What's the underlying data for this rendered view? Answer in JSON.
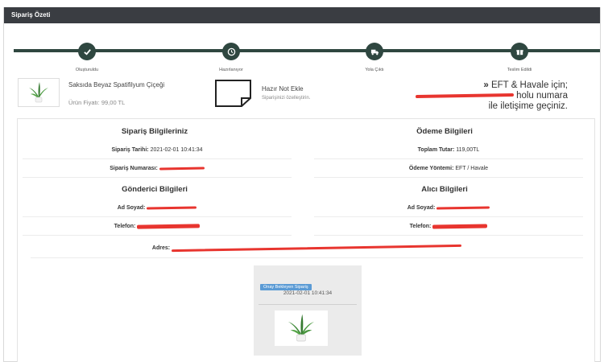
{
  "panel": {
    "title": "Sipariş Özeti"
  },
  "steps": [
    {
      "label": "Oluşturuldu",
      "icon": "check-icon"
    },
    {
      "label": "Hazırlanıyor",
      "icon": "clock-icon"
    },
    {
      "label": "Yola Çıktı",
      "icon": "truck-icon"
    },
    {
      "label": "Teslim Edildi",
      "icon": "gift-icon"
    }
  ],
  "product": {
    "name": "Saksıda Beyaz Spatifilyum Çiçeği",
    "price": "Ürün Fiyatı: 99,00 TL"
  },
  "note": {
    "title": "Hazır Not Ekle",
    "subtitle": "Siparişinizi özelleştirin."
  },
  "eft": {
    "line1": "EFT & Havale için;",
    "line2": "holu numara",
    "line3": "ile iletişime geçiniz."
  },
  "siparis": {
    "title": "Sipariş Bilgileriniz",
    "date_label": "Sipariş Tarihi:",
    "date_value": "2021-02-01 10:41:34",
    "number_label": "Sipariş Numarası:"
  },
  "odeme": {
    "title": "Ödeme Bilgileri",
    "total_label": "Toplam Tutar:",
    "total_value": "119,00TL",
    "method_label": "Ödeme Yöntemi:",
    "method_value": "EFT / Havale"
  },
  "gonderici": {
    "title": "Gönderici Bilgileri",
    "name_label": "Ad Soyad:",
    "phone_label": "Telefon:"
  },
  "alici": {
    "title": "Alıcı Bilgileri",
    "name_label": "Ad Soyad:",
    "phone_label": "Telefon:"
  },
  "address": {
    "label": "Adres:"
  },
  "status_card": {
    "badge": "Onay Bekleyen Sipariş",
    "date": "2021-02-01 10:41:34"
  },
  "colors": {
    "header": "#3a3d42",
    "tracker": "#2f4740",
    "redaction": "#e8352f",
    "badge": "#5b9bd5"
  }
}
